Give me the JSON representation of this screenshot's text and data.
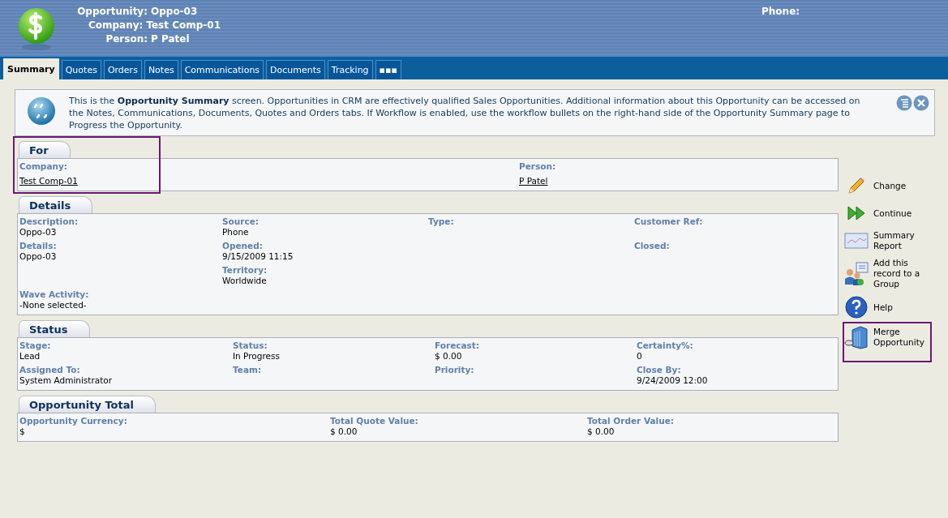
{
  "header": {
    "fields": [
      {
        "label": "Opportunity:",
        "value": "Oppo-03"
      },
      {
        "label": "Company:",
        "value": "Test Comp-01"
      },
      {
        "label": "Person:",
        "value": "P Patel"
      }
    ],
    "phone_label": "Phone:"
  },
  "tabs": [
    {
      "label": "Summary",
      "selected": true
    },
    {
      "label": "Quotes",
      "selected": false
    },
    {
      "label": "Orders",
      "selected": false
    },
    {
      "label": "Notes",
      "selected": false
    },
    {
      "label": "Communications",
      "selected": false
    },
    {
      "label": "Documents",
      "selected": false
    },
    {
      "label": "Tracking",
      "selected": false
    },
    {
      "label": "▪▪▪",
      "selected": false
    }
  ],
  "info": {
    "text": "This is the **Opportunity Summary** screen. Opportunities in CRM are effectively qualified Sales Opportunities. Additional information about this Opportunity can be accessed on the Notes, Communications, Documents, Quotes and Orders tabs. If Workflow is enabled, use the workflow bullets on the right-hand side of the Opportunity Summary page to Progress the Opportunity."
  },
  "sections": [
    {
      "title": "For",
      "highlighted": true,
      "kind": "for",
      "rows": [
        [
          {
            "label": "Company:",
            "value": "Test Comp-01",
            "link": true
          },
          {
            "label": "Person:",
            "value": "P Patel",
            "link": true
          }
        ]
      ]
    },
    {
      "title": "Details",
      "highlighted": false,
      "kind": "details",
      "rows": [
        [
          {
            "label": "Description:",
            "value": "Oppo-03"
          },
          {
            "label": "Source:",
            "value": "Phone"
          },
          {
            "label": "Type:"
          },
          {
            "label": "Customer Ref:"
          }
        ],
        [
          {
            "label": "Details:",
            "value": "Oppo-03"
          },
          {
            "label": "Opened:",
            "value": "9/15/2009 11:15"
          },
          {
            "kind": "blank"
          },
          {
            "label": "Closed:"
          }
        ],
        [
          {
            "kind": "blank"
          },
          {
            "label": "Territory:",
            "value": "Worldwide"
          }
        ],
        [
          {
            "label": "Wave Activity:",
            "value": "-None selected-"
          }
        ]
      ]
    },
    {
      "title": "Status",
      "highlighted": false,
      "kind": "status",
      "rows": [
        [
          {
            "label": "Stage:",
            "value": "Lead"
          },
          {
            "label": "Status:",
            "value": "In Progress"
          },
          {
            "label": "Forecast:",
            "value": "$ 0.00"
          },
          {
            "label": "Certainty%:",
            "value": "0"
          }
        ],
        [
          {
            "label": "Assigned To:",
            "value": "System Administrator"
          },
          {
            "label": "Team:"
          },
          {
            "label": "Priority:"
          },
          {
            "label": "Close By:",
            "value": "9/24/2009 12:00"
          }
        ]
      ]
    },
    {
      "title": "Opportunity Total",
      "highlighted": false,
      "kind": "total",
      "rows": [
        [
          {
            "label": "Opportunity Currency:",
            "value": "$"
          },
          {
            "label": "Total Quote Value:",
            "value": "$ 0.00"
          },
          {
            "label": "Total Order Value:",
            "value": "$ 0.00"
          }
        ]
      ]
    }
  ],
  "actions": [
    {
      "kind": "change",
      "label": "Change",
      "highlighted": false
    },
    {
      "kind": "continue",
      "label": "Continue",
      "highlighted": false
    },
    {
      "kind": "report",
      "label": "Summary Report",
      "highlighted": false
    },
    {
      "kind": "group",
      "label": "Add this record to a Group",
      "highlighted": false
    },
    {
      "kind": "help",
      "label": "Help",
      "highlighted": false
    },
    {
      "kind": "merge",
      "label": "Merge Opportunity",
      "highlighted": true
    }
  ]
}
